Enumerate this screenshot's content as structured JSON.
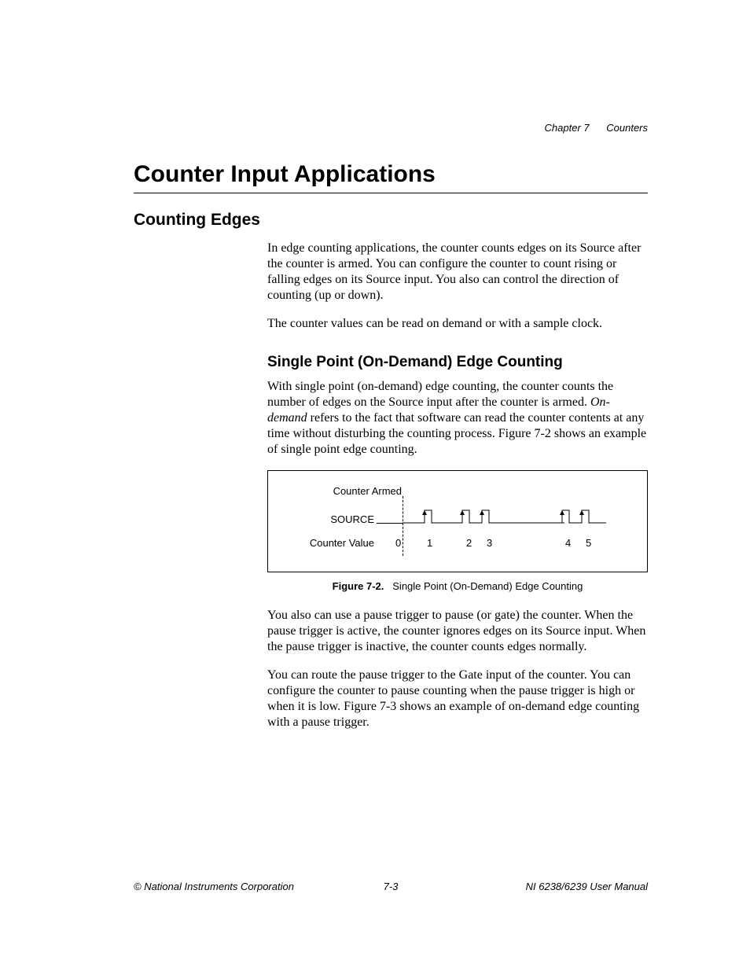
{
  "running_head": {
    "chapter": "Chapter 7",
    "title": "Counters"
  },
  "h1": "Counter Input Applications",
  "h2": "Counting Edges",
  "para1": "In edge counting applications, the counter counts edges on its Source after the counter is armed. You can configure the counter to count rising or falling edges on its Source input. You also can control the direction of counting (up or down).",
  "para2": "The counter values can be read on demand or with a sample clock.",
  "h3": "Single Point (On-Demand) Edge Counting",
  "para3a": "With single point (on-demand) edge counting, the counter counts the number of edges on the Source input after the counter is armed. ",
  "para3_em": "On-demand",
  "para3b": " refers to the fact that software can read the counter contents at any time without disturbing the counting process. Figure 7-2 shows an example of single point edge counting.",
  "figure": {
    "armed_label": "Counter Armed",
    "source_label": "SOURCE",
    "cval_label": "Counter Value",
    "values": [
      "0",
      "1",
      "2",
      "3",
      "4",
      "5"
    ],
    "caption_num": "Figure 7-2.",
    "caption_text": "Single Point (On-Demand) Edge Counting"
  },
  "para4": "You also can use a pause trigger to pause (or gate) the counter. When the pause trigger is active, the counter ignores edges on its Source input. When the pause trigger is inactive, the counter counts edges normally.",
  "para5": "You can route the pause trigger to the Gate input of the counter. You can configure the counter to pause counting when the pause trigger is high or when it is low. Figure 7-3 shows an example of on-demand edge counting with a pause trigger.",
  "footer": {
    "left": "© National Instruments Corporation",
    "center": "7-3",
    "right": "NI 6238/6239 User Manual"
  }
}
